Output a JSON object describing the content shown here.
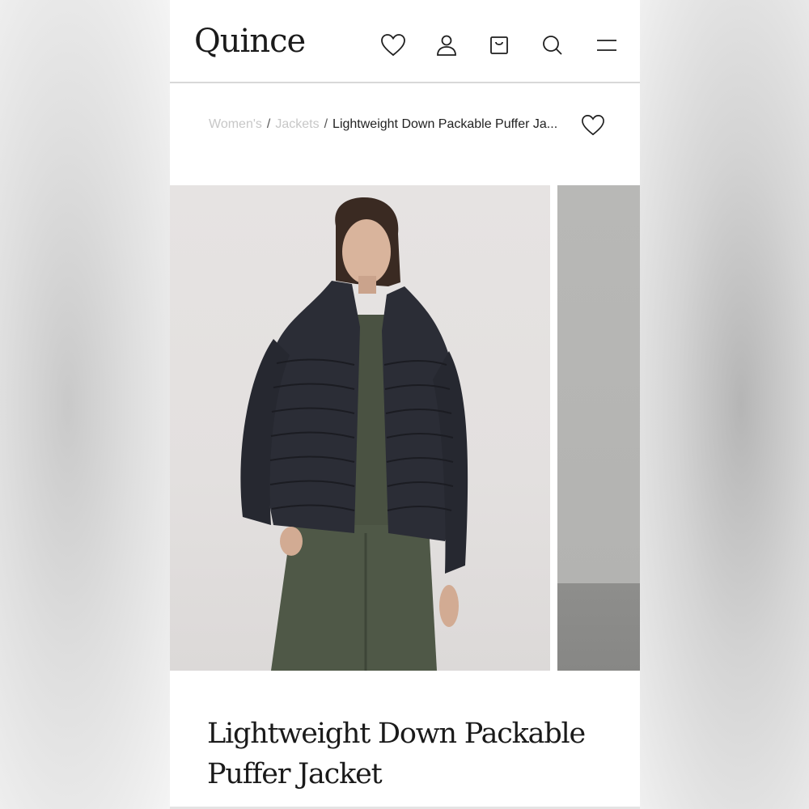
{
  "brand": {
    "logo_text": "Quince"
  },
  "header_icons": [
    {
      "name": "heart-icon",
      "label": "Wishlist"
    },
    {
      "name": "user-icon",
      "label": "Account"
    },
    {
      "name": "bag-icon",
      "label": "Cart"
    },
    {
      "name": "search-icon",
      "label": "Search"
    },
    {
      "name": "menu-icon",
      "label": "Menu"
    }
  ],
  "breadcrumb": {
    "level1": "Women's",
    "level2": "Jackets",
    "current": "Lightweight Down Packable Puffer Ja...",
    "separator": "/"
  },
  "product": {
    "title": "Lightweight Down Packable Puffer Jacket"
  },
  "colors": {
    "text": "#1a1a1a",
    "muted_link": "#c7c7c7",
    "divider": "#d8d8d8"
  }
}
